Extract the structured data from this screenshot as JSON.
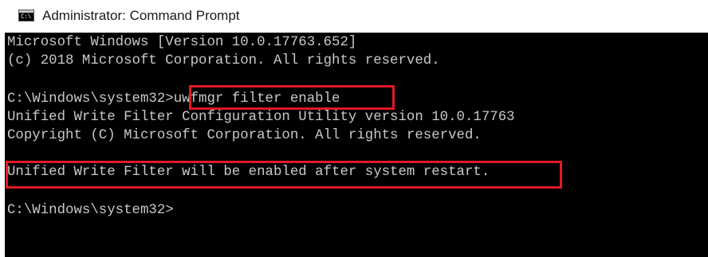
{
  "window": {
    "title": "Administrator: Command Prompt",
    "icon": "cmd-icon",
    "icon_glyph": "C:\\"
  },
  "console": {
    "lines": [
      "Microsoft Windows [Version 10.0.17763.652]",
      "(c) 2018 Microsoft Corporation. All rights reserved.",
      "",
      "C:\\Windows\\system32>uwfmgr filter enable",
      "Unified Write Filter Configuration Utility version 10.0.17763",
      "Copyright (C) Microsoft Corporation. All rights reserved.",
      "",
      "Unified Write Filter will be enabled after system restart.",
      "",
      "C:\\Windows\\system32>"
    ],
    "prompt": "C:\\Windows\\system32>",
    "command": "uwfmgr filter enable",
    "background": "#000000",
    "text_color": "#c8c8c8"
  },
  "highlights": {
    "color": "#e21a23",
    "items": [
      "command",
      "restart-message"
    ]
  }
}
